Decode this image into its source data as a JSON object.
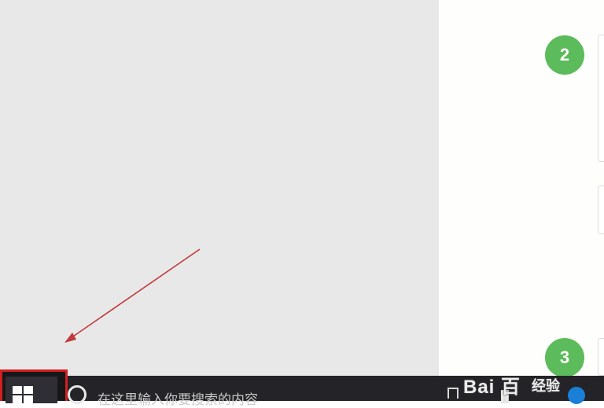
{
  "badges": {
    "step_2": "2",
    "step_3": "3"
  },
  "taskbar": {
    "search_placeholder": "在这里输入你要搜索的内容",
    "start_button": {
      "icon": "windows-logo-icon"
    }
  },
  "watermark": {
    "logo": "Bai 百",
    "sub": "经验"
  },
  "colors": {
    "badge": "#5cbb5a",
    "highlight": "#d21f1f",
    "arrow": "#c0393b",
    "taskbar": "#232328"
  }
}
